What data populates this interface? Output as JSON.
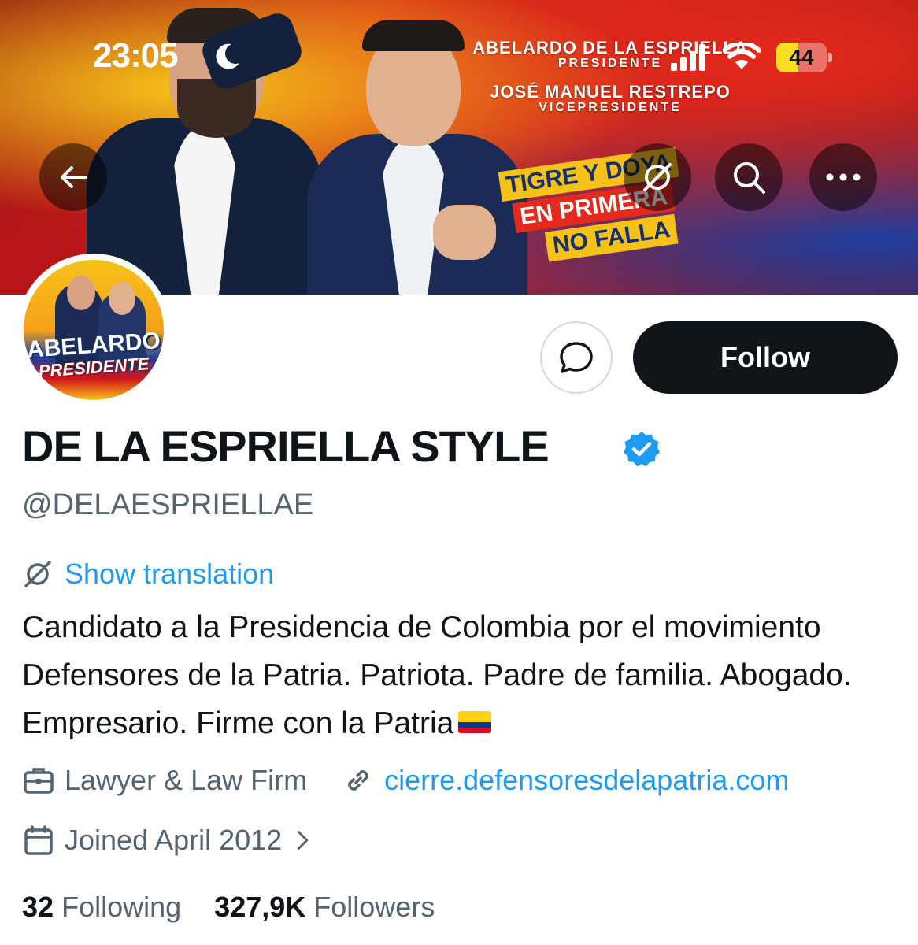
{
  "status_bar": {
    "time": "23:05",
    "battery_level": "44",
    "battery_fraction": 0.44
  },
  "banner": {
    "line1": "ABELARDO DE LA ESPRIELLA",
    "line2": "PRESIDENTE",
    "line3": "JOSÉ MANUEL RESTREPO",
    "line4": "VICEPRESIDENTE",
    "slogan1": "TIGRE Y DOYA",
    "slogan2": "EN PRIMERA",
    "slogan3": "NO FALLA"
  },
  "avatar": {
    "line1": "ABELARDO",
    "line2": "PRESIDENTE"
  },
  "actions": {
    "follow_label": "Follow"
  },
  "profile": {
    "display_name": "DE LA ESPRIELLA STYLE",
    "handle": "@DELAESPRIELLAE",
    "show_translation": "Show translation",
    "bio": "Candidato a la Presidencia de Colombia por el movimiento Defensores de la Patria. Patriota. Padre de familia. Abogado. Empresario. Firme con la Patria",
    "category": "Lawyer & Law Firm",
    "website": "cierre.defensoresdelapatria.com",
    "joined": "Joined April 2012",
    "following_count": "32",
    "following_label": "Following",
    "followers_count": "327,9K",
    "followers_label": "Followers"
  },
  "colors": {
    "accent": "#1d9bf0",
    "primary_text": "#0f1419",
    "secondary_text": "#536471",
    "follow_bg": "#0f1419"
  },
  "icons": [
    "back-arrow-icon",
    "translate-icon",
    "search-icon",
    "more-icon",
    "message-icon",
    "verified-badge-icon",
    "briefcase-icon",
    "link-icon",
    "calendar-icon",
    "chevron-right-icon",
    "colombia-flag-emoji"
  ]
}
